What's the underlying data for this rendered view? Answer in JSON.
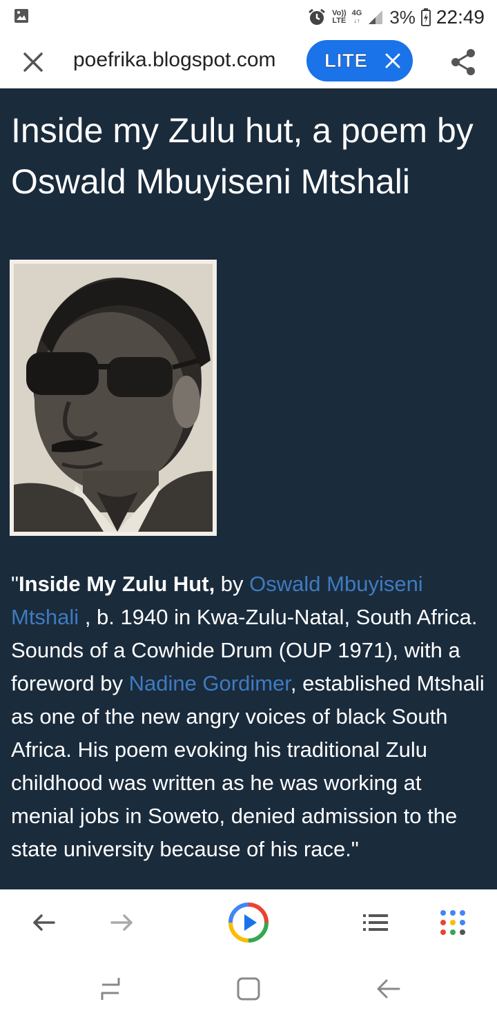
{
  "status_bar": {
    "volte_top": "Vo))",
    "volte_bottom": "LTE",
    "network": "4G",
    "battery": "3%",
    "time": "22:49",
    "icons": [
      "gallery-icon",
      "alarm-icon",
      "signal-icon",
      "battery-charging-icon"
    ]
  },
  "url_bar": {
    "url": "poefrika.blogspot.com",
    "lite_label": "LITE",
    "icons": [
      "close-icon",
      "close-icon",
      "share-icon"
    ],
    "accent": "#1a73e8"
  },
  "article": {
    "title": "Inside my Zulu hut, a poem by Oswald Mbuyiseni Mtshali",
    "bio_quote_open": "\"",
    "bio_bold": "Inside My Zulu Hut,",
    "bio_by": " by ",
    "bio_link_author": "Oswald Mbuyiseni Mtshali",
    "bio_mid1": " , b. 1940 in Kwa-Zulu-Natal, South Africa. Sounds of a Cowhide Drum (OUP 1971), with a foreword by ",
    "bio_link_gordimer": "Nadine Gordimer",
    "bio_rest": ", established Mtshali as one of the new angry voices of black South Africa. His poem evoking his traditional Zulu childhood was written as he was working at menial jobs in Soweto, denied admission to the state university because of his race.\"",
    "background": "#1a2b3c",
    "link_color": "#3f7bc0"
  },
  "toolbar": {
    "icons": [
      "back-arrow-icon",
      "forward-arrow-icon",
      "play-icon",
      "list-icon",
      "apps-grid-icon"
    ]
  },
  "navbar": {
    "icons": [
      "recent-apps-icon",
      "home-icon",
      "back-icon"
    ]
  }
}
